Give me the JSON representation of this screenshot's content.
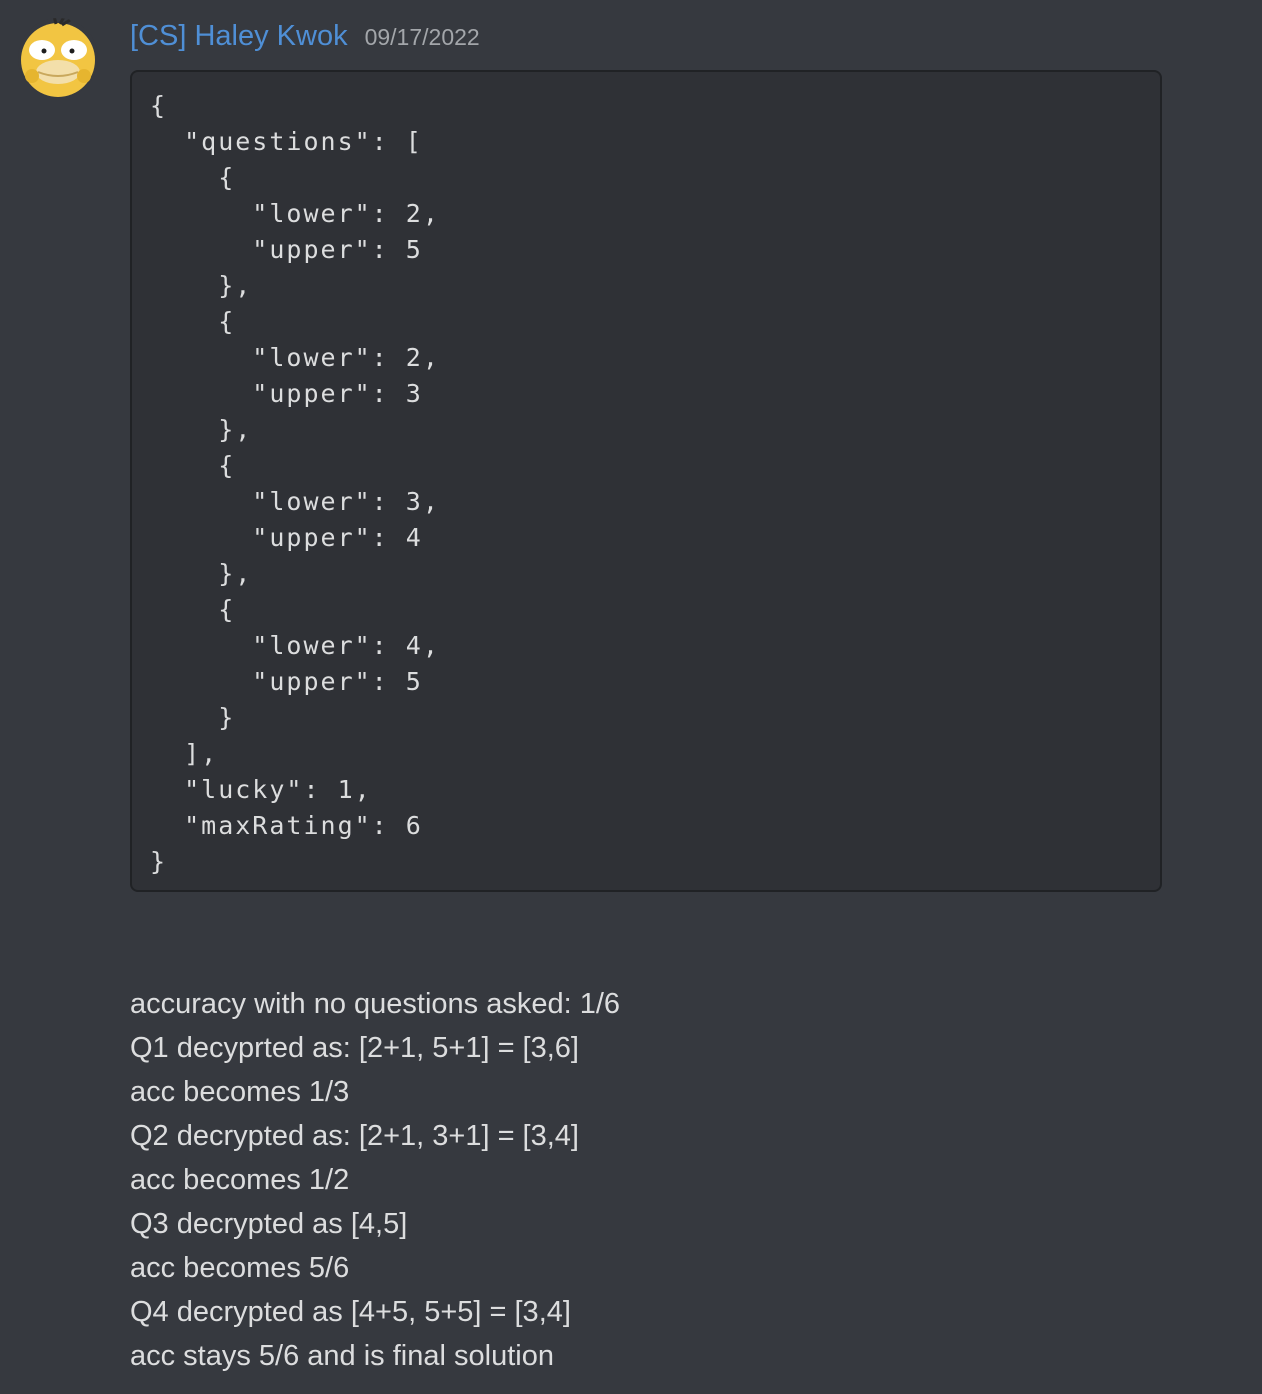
{
  "message": {
    "author": "[CS] Haley Kwok",
    "timestamp": "09/17/2022",
    "avatar_icon": "psyduck-avatar-icon",
    "code_block": "{\n  \"questions\": [\n    {\n      \"lower\": 2,\n      \"upper\": 5\n    },\n    {\n      \"lower\": 2,\n      \"upper\": 3\n    },\n    {\n      \"lower\": 3,\n      \"upper\": 4\n    },\n    {\n      \"lower\": 4,\n      \"upper\": 5\n    }\n  ],\n  \"lucky\": 1,\n  \"maxRating\": 6\n}",
    "lines": [
      "accuracy with no questions asked: 1/6",
      "Q1 decyprted as: [2+1, 5+1] = [3,6]",
      "acc becomes 1/3",
      "Q2 decrypted as: [2+1, 3+1] = [3,4]",
      "acc becomes 1/2",
      "Q3 decrypted as [4,5]",
      "acc becomes 5/6",
      "Q4 decrypted as [4+5, 5+5] = [3,4]",
      "acc stays 5/6 and is final solution"
    ]
  },
  "colors": {
    "background": "#36393f",
    "username": "#4f8fd6",
    "timestamp": "#a3a6aa",
    "code_background": "#2f3136",
    "text": "#dcddde"
  }
}
